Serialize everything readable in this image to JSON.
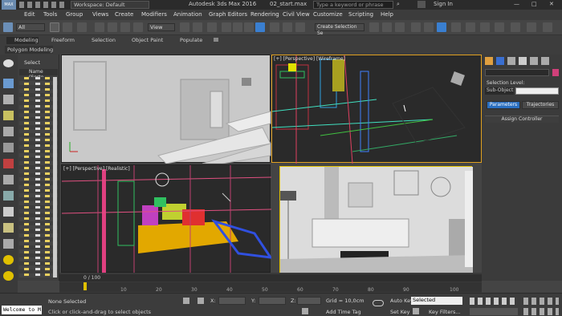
{
  "titlebar": {
    "workspace": "Workspace: Default",
    "app_title": "Autodesk 3ds Max 2016",
    "file_name": "02_start.max",
    "search_placeholder": "Type a keyword or phrase",
    "sign_in": "Sign In"
  },
  "menu": [
    "Edit",
    "Tools",
    "Group",
    "Views",
    "Create",
    "Modifiers",
    "Animation",
    "Graph Editors",
    "Rendering",
    "Civil View",
    "Customize",
    "Scripting",
    "Help"
  ],
  "toolbar": {
    "selection_filter": "All",
    "ref_coord": "View",
    "named_sel": "Create Selection Se"
  },
  "ribbon": {
    "tabs": [
      "Modeling",
      "Freeform",
      "Selection",
      "Object Paint",
      "Populate"
    ],
    "sub_tab": "Polygon Modeling"
  },
  "scene_explorer": {
    "select_label": "Select",
    "col_name": "Name (Sorte"
  },
  "viewports": {
    "top_right_label": "[+] [Perspective] [Wireframe]",
    "bottom_left_label": "[+] [Perspective] [Realistic]"
  },
  "command_panel": {
    "selection_level": "Selection Level:",
    "sub_object": "Sub-Object",
    "parameters": "Parameters",
    "trajectories": "Trajectories",
    "assign_controller": "Assign Controller"
  },
  "timeline": {
    "frame_counter": "0 / 100",
    "ticks": [
      "10",
      "20",
      "30",
      "40",
      "50",
      "60",
      "70",
      "80",
      "90",
      "100"
    ]
  },
  "status": {
    "maxscript": "Welcome to M",
    "selection": "None Selected",
    "prompt": "Click or click-and-drag to select objects",
    "x_label": "X:",
    "y_label": "Y:",
    "z_label": "Z:",
    "grid": "Grid = 10,0cm",
    "add_time_tag": "Add Time Tag",
    "auto_key": "Auto Key",
    "selected": "Selected",
    "set_key": "Set Key",
    "key_filters": "Key Filters..."
  },
  "colors": {
    "accent_blue": "#2a6fc0",
    "active_border": "#e0a020",
    "gizmo_yellow": "#e0c000"
  }
}
